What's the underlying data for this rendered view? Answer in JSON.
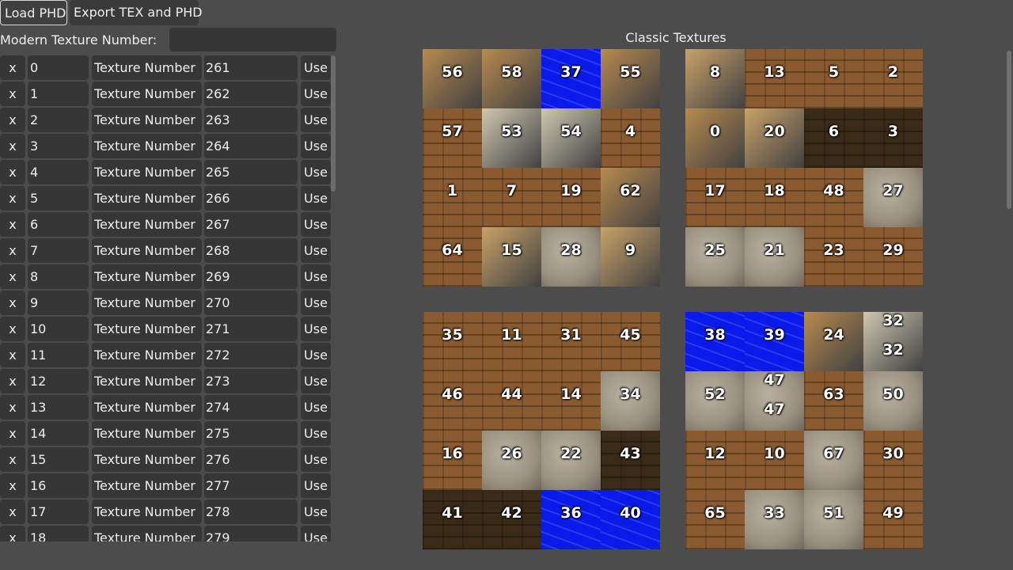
{
  "toolbar": {
    "load_label": "Load PHD",
    "export_label": "Export TEX and PHD"
  },
  "modern": {
    "label": "Modern Texture Number:",
    "value": ""
  },
  "list": {
    "remove_label": "x",
    "field_label": "Texture Number",
    "use_label": "Use",
    "rows": [
      {
        "index": "0",
        "number": "261"
      },
      {
        "index": "1",
        "number": "262"
      },
      {
        "index": "2",
        "number": "263"
      },
      {
        "index": "3",
        "number": "264"
      },
      {
        "index": "4",
        "number": "265"
      },
      {
        "index": "5",
        "number": "266"
      },
      {
        "index": "6",
        "number": "267"
      },
      {
        "index": "7",
        "number": "268"
      },
      {
        "index": "8",
        "number": "269"
      },
      {
        "index": "9",
        "number": "270"
      },
      {
        "index": "10",
        "number": "271"
      },
      {
        "index": "11",
        "number": "272"
      },
      {
        "index": "12",
        "number": "273"
      },
      {
        "index": "13",
        "number": "274"
      },
      {
        "index": "14",
        "number": "275"
      },
      {
        "index": "15",
        "number": "276"
      },
      {
        "index": "16",
        "number": "277"
      },
      {
        "index": "17",
        "number": "278"
      },
      {
        "index": "18",
        "number": "279"
      }
    ]
  },
  "classic": {
    "title": "Classic Textures",
    "colors": {
      "sand": "#b88a4e",
      "brick": "#8a5a30",
      "tan": "#c8a268",
      "stone": "#9a9080",
      "water": "#0a1ae8",
      "dark": "#3a2a18",
      "pale": "#cfc8b0"
    },
    "atlases": [
      {
        "tiles": [
          {
            "labels": [
              "56"
            ],
            "color": "sand"
          },
          {
            "labels": [
              "58"
            ],
            "color": "sand"
          },
          {
            "labels": [
              "37"
            ],
            "color": "water"
          },
          {
            "labels": [
              "55"
            ],
            "color": "sand"
          },
          {
            "labels": [
              "57"
            ],
            "color": "brick"
          },
          {
            "labels": [
              "53"
            ],
            "color": "pale"
          },
          {
            "labels": [
              "54"
            ],
            "color": "pale"
          },
          {
            "labels": [
              "4"
            ],
            "color": "brick"
          },
          {
            "labels": [
              "1"
            ],
            "color": "brick"
          },
          {
            "labels": [
              "7"
            ],
            "color": "brick"
          },
          {
            "labels": [
              "19"
            ],
            "color": "brick"
          },
          {
            "labels": [
              "62"
            ],
            "color": "sand"
          },
          {
            "labels": [
              "64"
            ],
            "color": "brick"
          },
          {
            "labels": [
              "15"
            ],
            "color": "tan"
          },
          {
            "labels": [
              "28"
            ],
            "color": "stone"
          },
          {
            "labels": [
              "9"
            ],
            "color": "tan"
          }
        ]
      },
      {
        "tiles": [
          {
            "labels": [
              "8"
            ],
            "color": "tan"
          },
          {
            "labels": [
              "13"
            ],
            "color": "brick"
          },
          {
            "labels": [
              "5"
            ],
            "color": "brick"
          },
          {
            "labels": [
              "2"
            ],
            "color": "brick"
          },
          {
            "labels": [
              "0"
            ],
            "color": "sand"
          },
          {
            "labels": [
              "20"
            ],
            "color": "tan"
          },
          {
            "labels": [
              "6"
            ],
            "color": "dark"
          },
          {
            "labels": [
              "3"
            ],
            "color": "dark"
          },
          {
            "labels": [
              "17"
            ],
            "color": "brick"
          },
          {
            "labels": [
              "18"
            ],
            "color": "brick"
          },
          {
            "labels": [
              "48"
            ],
            "color": "brick"
          },
          {
            "labels": [
              "27"
            ],
            "color": "stone"
          },
          {
            "labels": [
              "25"
            ],
            "color": "stone"
          },
          {
            "labels": [
              "21"
            ],
            "color": "stone"
          },
          {
            "labels": [
              "23"
            ],
            "color": "brick"
          },
          {
            "labels": [
              "29"
            ],
            "color": "brick"
          }
        ]
      },
      {
        "tiles": [
          {
            "labels": [
              "35"
            ],
            "color": "brick"
          },
          {
            "labels": [
              "11"
            ],
            "color": "brick"
          },
          {
            "labels": [
              "31"
            ],
            "color": "brick"
          },
          {
            "labels": [
              "45"
            ],
            "color": "brick"
          },
          {
            "labels": [
              "46"
            ],
            "color": "brick"
          },
          {
            "labels": [
              "44"
            ],
            "color": "brick"
          },
          {
            "labels": [
              "14"
            ],
            "color": "brick"
          },
          {
            "labels": [
              "34"
            ],
            "color": "stone"
          },
          {
            "labels": [
              "16"
            ],
            "color": "brick"
          },
          {
            "labels": [
              "26"
            ],
            "color": "stone"
          },
          {
            "labels": [
              "22"
            ],
            "color": "stone"
          },
          {
            "labels": [
              "43"
            ],
            "color": "dark"
          },
          {
            "labels": [
              "41"
            ],
            "color": "dark"
          },
          {
            "labels": [
              "42"
            ],
            "color": "dark"
          },
          {
            "labels": [
              "36"
            ],
            "color": "water"
          },
          {
            "labels": [
              "40"
            ],
            "color": "water"
          }
        ]
      },
      {
        "tiles": [
          {
            "labels": [
              "38"
            ],
            "color": "water"
          },
          {
            "labels": [
              "39"
            ],
            "color": "water"
          },
          {
            "labels": [
              "24"
            ],
            "color": "sand"
          },
          {
            "labels": [
              "32",
              "32"
            ],
            "color": "pale"
          },
          {
            "labels": [
              "52"
            ],
            "color": "stone"
          },
          {
            "labels": [
              "47",
              "47"
            ],
            "color": "stone"
          },
          {
            "labels": [
              "63"
            ],
            "color": "brick"
          },
          {
            "labels": [
              "50"
            ],
            "color": "stone"
          },
          {
            "labels": [
              "12"
            ],
            "color": "brick"
          },
          {
            "labels": [
              "10"
            ],
            "color": "brick"
          },
          {
            "labels": [
              "67"
            ],
            "color": "stone"
          },
          {
            "labels": [
              "30"
            ],
            "color": "brick"
          },
          {
            "labels": [
              "65"
            ],
            "color": "brick"
          },
          {
            "labels": [
              "33"
            ],
            "color": "stone"
          },
          {
            "labels": [
              "51"
            ],
            "color": "stone"
          },
          {
            "labels": [
              "49"
            ],
            "color": "brick"
          }
        ]
      }
    ]
  }
}
